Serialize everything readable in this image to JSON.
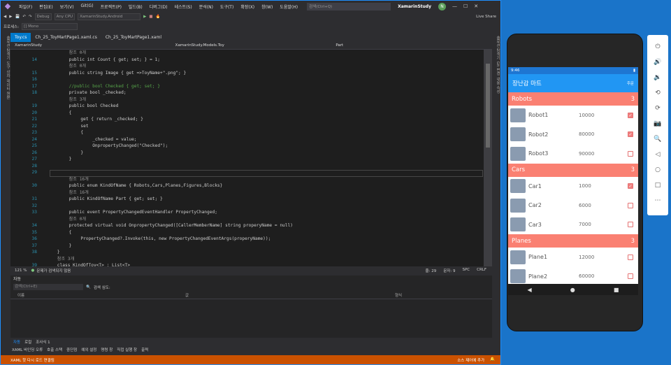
{
  "menu": {
    "items": [
      "파일(F)",
      "편집(E)",
      "보기(V)",
      "Git(G)",
      "프로젝트(P)",
      "빌드(B)",
      "디버그(D)",
      "테스트(S)",
      "분석(N)",
      "도구(T)",
      "확장(X)",
      "창(W)",
      "도움말(H)"
    ],
    "search": "검색(Ctrl+Q)",
    "project": "XamarinStudy",
    "avatar": "N",
    "live_share": "Live Share"
  },
  "toolbar": {
    "config": "Debug",
    "platform": "Any CPU",
    "target": "XamarinStudy.Android",
    "scope_label": "프로세스:",
    "scope": "[] Mono"
  },
  "tabs": [
    "Toy.cs",
    "Ch_25_ToyMartPage1.xaml.cs",
    "Ch_25_ToyMartPage1.xaml"
  ],
  "nav": {
    "project": "XamarinStudy",
    "class": "XamarinStudy.Models.Toy",
    "member": "Part"
  },
  "left_strip": "솔루션 탐색기  도구 상자  데이터 원본",
  "right_strip": "솔루션 탐색기  Git 변경 내용  속성",
  "code": [
    {
      "n": "",
      "t": "참조 0개",
      "c": "ref",
      "i": 8
    },
    {
      "n": "14",
      "t": "public int Count { get; set; } = 1;",
      "c": "",
      "i": 8
    },
    {
      "n": "",
      "t": "참조 0개",
      "c": "ref",
      "i": 8
    },
    {
      "n": "15",
      "t": "public string Image { get =>ToyName+\".png\"; }",
      "c": "",
      "i": 8
    },
    {
      "n": "16",
      "t": "",
      "c": "",
      "i": 0
    },
    {
      "n": "17",
      "t": "//public bool Checked { get; set; }",
      "c": "cm",
      "i": 8
    },
    {
      "n": "18",
      "t": "private bool _checked;",
      "c": "",
      "i": 8
    },
    {
      "n": "",
      "t": "참조 3개",
      "c": "ref",
      "i": 8
    },
    {
      "n": "19",
      "t": "public bool Checked",
      "c": "",
      "i": 8
    },
    {
      "n": "20",
      "t": "{",
      "c": "",
      "i": 8
    },
    {
      "n": "21",
      "t": "get { return _checked; }",
      "c": "",
      "i": 12
    },
    {
      "n": "22",
      "t": "set",
      "c": "",
      "i": 12
    },
    {
      "n": "23",
      "t": "{",
      "c": "",
      "i": 12
    },
    {
      "n": "24",
      "t": "_checked = value;",
      "c": "",
      "i": 16
    },
    {
      "n": "25",
      "t": "OnpropertyChanged(\"Checked\");",
      "c": "",
      "i": 16
    },
    {
      "n": "26",
      "t": "}",
      "c": "",
      "i": 12
    },
    {
      "n": "27",
      "t": "}",
      "c": "",
      "i": 8
    },
    {
      "n": "28",
      "t": "",
      "c": "",
      "i": 0
    },
    {
      "n": "29",
      "t": "",
      "c": "",
      "i": 0
    },
    {
      "n": "",
      "t": "참조 16개",
      "c": "ref",
      "i": 8
    },
    {
      "n": "30",
      "t": "public enum KindOfName { Robots,Cars,Planes,Figures,Blocks}",
      "c": "",
      "i": 8
    },
    {
      "n": "",
      "t": "참조 16개",
      "c": "ref",
      "i": 8
    },
    {
      "n": "31",
      "t": "public KindOfName Part { get; set; }",
      "c": "",
      "i": 8
    },
    {
      "n": "32",
      "t": "",
      "c": "",
      "i": 0
    },
    {
      "n": "33",
      "t": "public event PropertyChangedEventHandler PropertyChanged;",
      "c": "",
      "i": 8
    },
    {
      "n": "",
      "t": "참조 0개",
      "c": "ref",
      "i": 8
    },
    {
      "n": "34",
      "t": "protected virtual void OnpropertyChanged([CallerMemberName] string properyName = null)",
      "c": "",
      "i": 8
    },
    {
      "n": "35",
      "t": "{",
      "c": "",
      "i": 8
    },
    {
      "n": "36",
      "t": "PropertyChanged?.Invoke(this, new PropertyChangedEventArgs(properyName));",
      "c": "",
      "i": 12
    },
    {
      "n": "37",
      "t": "}",
      "c": "",
      "i": 8
    },
    {
      "n": "38",
      "t": "}",
      "c": "",
      "i": 4
    },
    {
      "n": "",
      "t": "참조 3개",
      "c": "ref",
      "i": 4
    },
    {
      "n": "39",
      "t": "class KindOfToy<T> : List<T>",
      "c": "",
      "i": 4
    }
  ],
  "status_line": {
    "zoom": "121 %",
    "issues": "문제가 검색되지 않음",
    "line": "줄: 29",
    "char": "문자: 9",
    "spc": "SPC",
    "crlf": "CRLF"
  },
  "autos": {
    "title": "자동",
    "search": "검색(Ctrl+E)",
    "depth_label": "검색 심도:",
    "cols": [
      "이름",
      "값",
      "형식"
    ]
  },
  "bottom_tabs": [
    "자동",
    "로컬",
    "조사식 1"
  ],
  "bottom_tabs2": [
    "XAML 바인딩 오류",
    "호출 스택",
    "중단점",
    "예외 설정",
    "명령 창",
    "직접 실행 창",
    "출력"
  ],
  "statusbar": {
    "left": "XAML 핫 다시 로드 연결됨",
    "right": "소스 제어에 추가"
  },
  "phone": {
    "time": "9:46",
    "battery": "▮",
    "title": "장난감 마트",
    "action": "주문",
    "groups": [
      {
        "name": "Robots",
        "count": "3",
        "items": [
          {
            "name": "Robot1",
            "price": "10000",
            "checked": true
          },
          {
            "name": "Robot2",
            "price": "80000",
            "checked": true
          },
          {
            "name": "Robot3",
            "price": "90000",
            "checked": false
          }
        ]
      },
      {
        "name": "Cars",
        "count": "3",
        "items": [
          {
            "name": "Car1",
            "price": "1000",
            "checked": true
          },
          {
            "name": "Car2",
            "price": "6000",
            "checked": false
          },
          {
            "name": "Car3",
            "price": "7000",
            "checked": false
          }
        ]
      },
      {
        "name": "Planes",
        "count": "3",
        "items": [
          {
            "name": "Plane1",
            "price": "12000",
            "checked": false
          },
          {
            "name": "Plane2",
            "price": "60000",
            "checked": false
          }
        ]
      }
    ]
  },
  "colors": {
    "accent": "#007acc",
    "status": "#ca5100",
    "appbar": "#2196f3",
    "group": "#fa8072"
  }
}
